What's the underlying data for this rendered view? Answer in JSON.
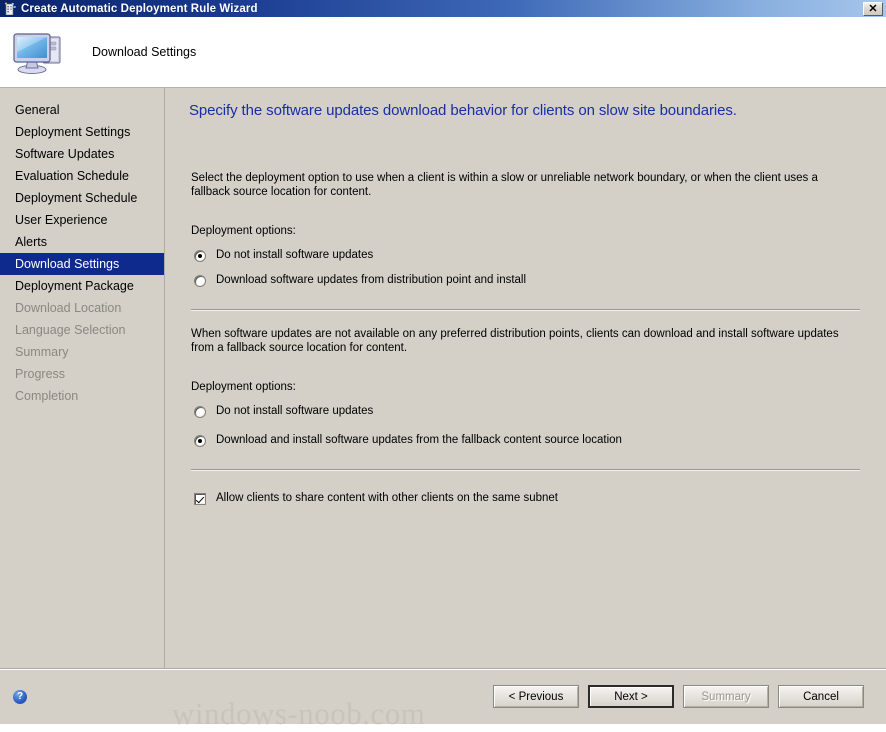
{
  "window": {
    "title": "Create Automatic Deployment Rule Wizard",
    "title_icon": "wizard-icon",
    "close_label": "✕"
  },
  "header": {
    "title": "Download Settings",
    "icon": "computer-icon"
  },
  "sidebar": {
    "items": [
      {
        "label": "General",
        "state": "normal"
      },
      {
        "label": "Deployment Settings",
        "state": "normal"
      },
      {
        "label": "Software Updates",
        "state": "normal"
      },
      {
        "label": "Evaluation Schedule",
        "state": "normal"
      },
      {
        "label": "Deployment Schedule",
        "state": "normal"
      },
      {
        "label": "User Experience",
        "state": "normal"
      },
      {
        "label": "Alerts",
        "state": "normal"
      },
      {
        "label": "Download Settings",
        "state": "selected"
      },
      {
        "label": "Deployment Package",
        "state": "normal"
      },
      {
        "label": "Download Location",
        "state": "disabled"
      },
      {
        "label": "Language Selection",
        "state": "disabled"
      },
      {
        "label": "Summary",
        "state": "disabled"
      },
      {
        "label": "Progress",
        "state": "disabled"
      },
      {
        "label": "Completion",
        "state": "disabled"
      }
    ]
  },
  "content": {
    "heading": "Specify the software updates download behavior for clients on slow site boundaries.",
    "intro_paragraph": "Select the deployment option to use when a client is within a slow or unreliable network boundary, or when the client uses a fallback source location for content.",
    "section1": {
      "label": "Deployment options:",
      "options": [
        {
          "label": "Do not install software updates",
          "checked": true
        },
        {
          "label": "Download software updates from distribution point and install",
          "checked": false
        }
      ]
    },
    "section2": {
      "paragraph": "When software updates are not available on any preferred distribution points, clients can download and install software updates from a fallback source location for content.",
      "label": "Deployment options:",
      "options": [
        {
          "label": "Do not install software updates",
          "checked": false
        },
        {
          "label": "Download and install software updates from the fallback content source location",
          "checked": true
        }
      ]
    },
    "checkbox": {
      "label": "Allow clients to share content with other clients on the same subnet",
      "checked": true
    }
  },
  "footer": {
    "help_icon": "?",
    "buttons": [
      {
        "label": "< Previous",
        "state": "normal"
      },
      {
        "label": "Next >",
        "state": "focused"
      },
      {
        "label": "Summary",
        "state": "disabled"
      },
      {
        "label": "Cancel",
        "state": "normal"
      }
    ]
  },
  "watermark": "windows-noob.com",
  "colors": {
    "titlebar_start": "#0a246a",
    "titlebar_end": "#a6c6ec",
    "window_bg": "#d4d0c8",
    "selection": "#0d2a8c",
    "heading": "#1b2ea0",
    "disabled_text": "#8b8880"
  }
}
